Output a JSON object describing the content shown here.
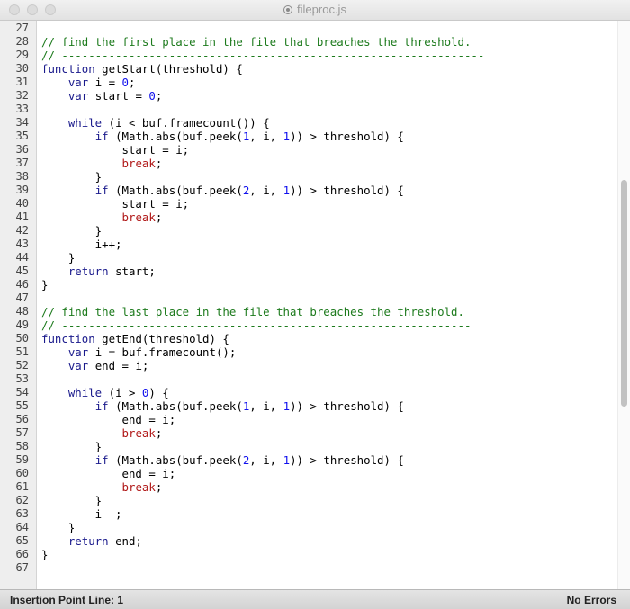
{
  "window": {
    "title": "fileproc.js"
  },
  "editor": {
    "line_numbers": [
      "27",
      "28",
      "29",
      "30",
      "31",
      "32",
      "33",
      "34",
      "35",
      "36",
      "37",
      "38",
      "39",
      "40",
      "41",
      "42",
      "43",
      "44",
      "45",
      "46",
      "47",
      "48",
      "49",
      "50",
      "51",
      "52",
      "53",
      "54",
      "55",
      "56",
      "57",
      "58",
      "59",
      "60",
      "61",
      "62",
      "63",
      "64",
      "65",
      "66",
      "67"
    ],
    "lines": [
      [],
      [
        [
          "cm",
          "// find the first place in the file that breaches the threshold."
        ]
      ],
      [
        [
          "cm",
          "// ---------------------------------------------------------------"
        ]
      ],
      [
        [
          "kw",
          "function"
        ],
        [
          "t",
          " getStart(threshold) {"
        ]
      ],
      [
        [
          "t",
          "    "
        ],
        [
          "kw",
          "var"
        ],
        [
          "t",
          " i = "
        ],
        [
          "num",
          "0"
        ],
        [
          "t",
          ";"
        ]
      ],
      [
        [
          "t",
          "    "
        ],
        [
          "kw",
          "var"
        ],
        [
          "t",
          " start = "
        ],
        [
          "num",
          "0"
        ],
        [
          "t",
          ";"
        ]
      ],
      [],
      [
        [
          "t",
          "    "
        ],
        [
          "kw",
          "while"
        ],
        [
          "t",
          " (i < buf.framecount()) {"
        ]
      ],
      [
        [
          "t",
          "        "
        ],
        [
          "kw",
          "if"
        ],
        [
          "t",
          " (Math.abs(buf.peek("
        ],
        [
          "num",
          "1"
        ],
        [
          "t",
          ", i, "
        ],
        [
          "num",
          "1"
        ],
        [
          "t",
          ")) > threshold) {"
        ]
      ],
      [
        [
          "t",
          "            start = i;"
        ]
      ],
      [
        [
          "t",
          "            "
        ],
        [
          "brk",
          "break"
        ],
        [
          "t",
          ";"
        ]
      ],
      [
        [
          "t",
          "        }"
        ]
      ],
      [
        [
          "t",
          "        "
        ],
        [
          "kw",
          "if"
        ],
        [
          "t",
          " (Math.abs(buf.peek("
        ],
        [
          "num",
          "2"
        ],
        [
          "t",
          ", i, "
        ],
        [
          "num",
          "1"
        ],
        [
          "t",
          ")) > threshold) {"
        ]
      ],
      [
        [
          "t",
          "            start = i;"
        ]
      ],
      [
        [
          "t",
          "            "
        ],
        [
          "brk",
          "break"
        ],
        [
          "t",
          ";"
        ]
      ],
      [
        [
          "t",
          "        }"
        ]
      ],
      [
        [
          "t",
          "        i++;"
        ]
      ],
      [
        [
          "t",
          "    }"
        ]
      ],
      [
        [
          "t",
          "    "
        ],
        [
          "kw",
          "return"
        ],
        [
          "t",
          " start;"
        ]
      ],
      [
        [
          "t",
          "}"
        ]
      ],
      [],
      [
        [
          "cm",
          "// find the last place in the file that breaches the threshold."
        ]
      ],
      [
        [
          "cm",
          "// -------------------------------------------------------------"
        ]
      ],
      [
        [
          "kw",
          "function"
        ],
        [
          "t",
          " getEnd(threshold) {"
        ]
      ],
      [
        [
          "t",
          "    "
        ],
        [
          "kw",
          "var"
        ],
        [
          "t",
          " i = buf.framecount();"
        ]
      ],
      [
        [
          "t",
          "    "
        ],
        [
          "kw",
          "var"
        ],
        [
          "t",
          " end = i;"
        ]
      ],
      [],
      [
        [
          "t",
          "    "
        ],
        [
          "kw",
          "while"
        ],
        [
          "t",
          " (i > "
        ],
        [
          "num",
          "0"
        ],
        [
          "t",
          ") {"
        ]
      ],
      [
        [
          "t",
          "        "
        ],
        [
          "kw",
          "if"
        ],
        [
          "t",
          " (Math.abs(buf.peek("
        ],
        [
          "num",
          "1"
        ],
        [
          "t",
          ", i, "
        ],
        [
          "num",
          "1"
        ],
        [
          "t",
          ")) > threshold) {"
        ]
      ],
      [
        [
          "t",
          "            end = i;"
        ]
      ],
      [
        [
          "t",
          "            "
        ],
        [
          "brk",
          "break"
        ],
        [
          "t",
          ";"
        ]
      ],
      [
        [
          "t",
          "        }"
        ]
      ],
      [
        [
          "t",
          "        "
        ],
        [
          "kw",
          "if"
        ],
        [
          "t",
          " (Math.abs(buf.peek("
        ],
        [
          "num",
          "2"
        ],
        [
          "t",
          ", i, "
        ],
        [
          "num",
          "1"
        ],
        [
          "t",
          ")) > threshold) {"
        ]
      ],
      [
        [
          "t",
          "            end = i;"
        ]
      ],
      [
        [
          "t",
          "            "
        ],
        [
          "brk",
          "break"
        ],
        [
          "t",
          ";"
        ]
      ],
      [
        [
          "t",
          "        }"
        ]
      ],
      [
        [
          "t",
          "        i--;"
        ]
      ],
      [
        [
          "t",
          "    }"
        ]
      ],
      [
        [
          "t",
          "    "
        ],
        [
          "kw",
          "return"
        ],
        [
          "t",
          " end;"
        ]
      ],
      [
        [
          "t",
          "}"
        ]
      ],
      []
    ]
  },
  "statusbar": {
    "left": "Insertion Point Line: 1",
    "right": "No Errors"
  },
  "colors": {
    "keyword": "#1a1a8c",
    "number": "#1010ee",
    "comment": "#1c7a1c",
    "break": "#b01818"
  }
}
